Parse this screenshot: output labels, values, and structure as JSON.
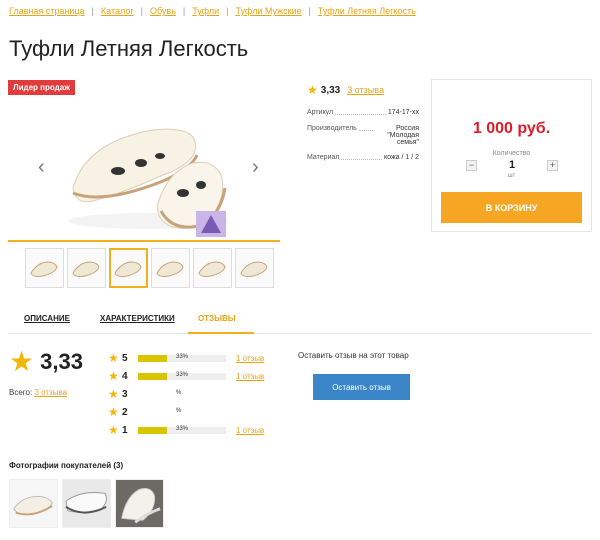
{
  "breadcrumb": [
    {
      "label": "Главная страница"
    },
    {
      "label": "Каталог"
    },
    {
      "label": "Обувь"
    },
    {
      "label": "Туфли"
    },
    {
      "label": "Туфли Мужские"
    },
    {
      "label": "Туфли Летняя Легкость"
    }
  ],
  "product": {
    "title": "Туфли Летняя Легкость",
    "badge": "Лидер продаж",
    "rating": "3,33",
    "reviews_link": "3 отзыва",
    "specs": [
      {
        "label": "Артикул",
        "value": "174-17-xx"
      },
      {
        "label": "Производитель",
        "value": "Россия \"Молодая семья\""
      },
      {
        "label": "Материал",
        "value": "кожа / 1 / 2"
      }
    ]
  },
  "purchase": {
    "price": "1 000 руб.",
    "qty_label": "Количество",
    "qty_value": "1",
    "qty_unit": "шт",
    "minus": "−",
    "plus": "+",
    "cart_button": "В КОРЗИНУ"
  },
  "tabs": [
    "ОПИСАНИЕ",
    "ХАРАКТЕРИСТИКИ",
    "ОТЗЫВЫ"
  ],
  "reviews": {
    "average": "3,33",
    "total_label": "Всего:",
    "total_link": "3 отзыва",
    "distribution": [
      {
        "stars": "5",
        "percent": "33%",
        "fraction": 0.33,
        "link": "1 отзыв"
      },
      {
        "stars": "4",
        "percent": "33%",
        "fraction": 0.33,
        "link": "1 отзыв"
      },
      {
        "stars": "3",
        "percent": "%",
        "fraction": 0,
        "link": ""
      },
      {
        "stars": "2",
        "percent": "%",
        "fraction": 0,
        "link": ""
      },
      {
        "stars": "1",
        "percent": "33%",
        "fraction": 0.33,
        "link": "1 отзыв"
      }
    ],
    "leave_text": "Оставить отзыв на этот товар",
    "leave_button": "Оставить отзыв"
  },
  "photos": {
    "title": "Фотографии покупателей (3)"
  },
  "colors": {
    "accent": "#f0b020",
    "link": "#e8a317",
    "price": "#d81e2b",
    "badge": "#e23b3b",
    "cart": "#f6a623",
    "review_button": "#3b86c8"
  },
  "icons": {
    "prev": "chevron-left-icon",
    "next": "chevron-right-icon",
    "star": "star-icon"
  }
}
